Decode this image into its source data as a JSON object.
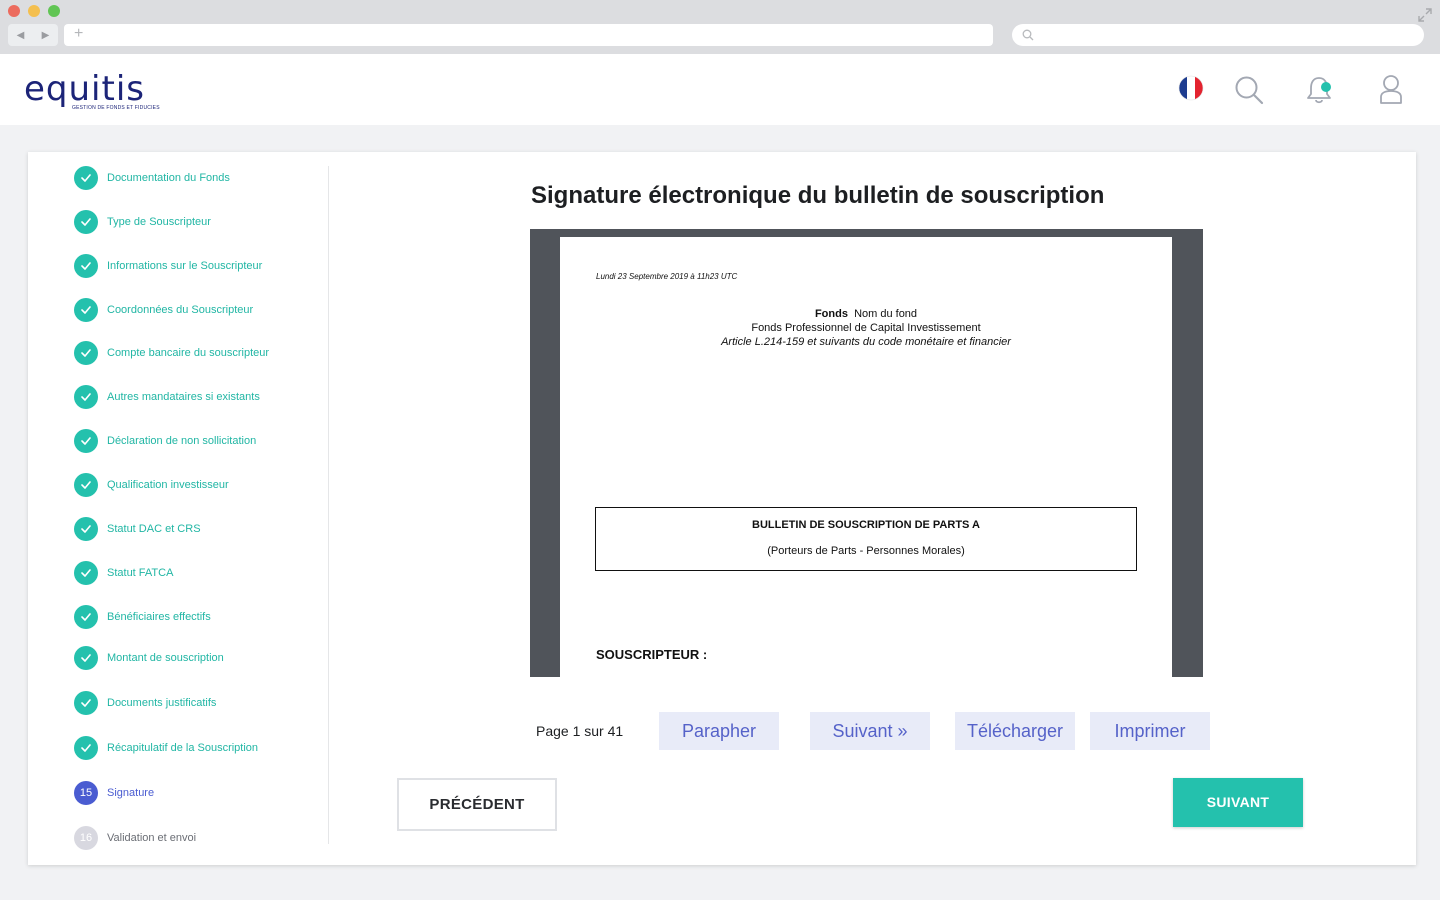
{
  "browser": {
    "new_tab_glyph": "+",
    "back_glyph": "◀",
    "forward_glyph": "▶"
  },
  "header": {
    "logo_text": "equitis",
    "logo_tagline": "GESTION DE FONDS ET FIDUCIES",
    "icons": [
      "france-flag-icon",
      "search-icon",
      "notification-bell-icon",
      "user-icon"
    ],
    "notification_dot_color": "#24c1ad"
  },
  "sidebar": {
    "steps": [
      {
        "label": "Documentation du Fonds",
        "state": "done"
      },
      {
        "label": "Type de Souscripteur",
        "state": "done"
      },
      {
        "label": "Informations sur le Souscripteur",
        "state": "done"
      },
      {
        "label": "Coordonnées du Souscripteur",
        "state": "done"
      },
      {
        "label": "Compte bancaire du souscripteur",
        "state": "done"
      },
      {
        "label": "Autres mandataires si existants",
        "state": "done"
      },
      {
        "label": "Déclaration de non sollicitation",
        "state": "done"
      },
      {
        "label": "Qualification investisseur",
        "state": "done"
      },
      {
        "label": "Statut DAC et CRS",
        "state": "done"
      },
      {
        "label": "Statut FATCA",
        "state": "done"
      },
      {
        "label": "Bénéficiaires effectifs",
        "state": "done"
      },
      {
        "label": "Montant de souscription",
        "state": "done"
      },
      {
        "label": "Documents justificatifs",
        "state": "done"
      },
      {
        "label": "Récapitulatif de la Souscription",
        "state": "done"
      },
      {
        "label": "Signature",
        "state": "current",
        "number": "15"
      },
      {
        "label": "Validation et envoi",
        "state": "pending",
        "number": "16"
      }
    ]
  },
  "main": {
    "title": "Signature électronique du bulletin de souscription",
    "document": {
      "date": "Lundi 23 Septembre 2019 à 11h23 UTC",
      "fund_bold": "Fonds",
      "fund_name": "Nom du fond",
      "fund_type": "Fonds Professionnel de Capital Investissement",
      "fund_article": "Article L.214-159 et suivants du code monétaire et financier",
      "box_title": "BULLETIN DE SOUSCRIPTION DE PARTS A",
      "box_subtitle": "(Porteurs de Parts - Personnes Morales)",
      "subscriber_heading": "SOUSCRIPTEUR :"
    },
    "viewer": {
      "page_count": "Page 1 sur 41",
      "buttons": {
        "parapher": "Parapher",
        "suivant": "Suivant »",
        "telecharger": "Télécharger",
        "imprimer": "Imprimer"
      }
    },
    "nav": {
      "prev_label": "PRÉCÉDENT",
      "next_label": "SUIVANT"
    }
  },
  "colors": {
    "accent": "#24c1ad",
    "current_step": "#4a5cd1",
    "brand": "#1c2478"
  }
}
